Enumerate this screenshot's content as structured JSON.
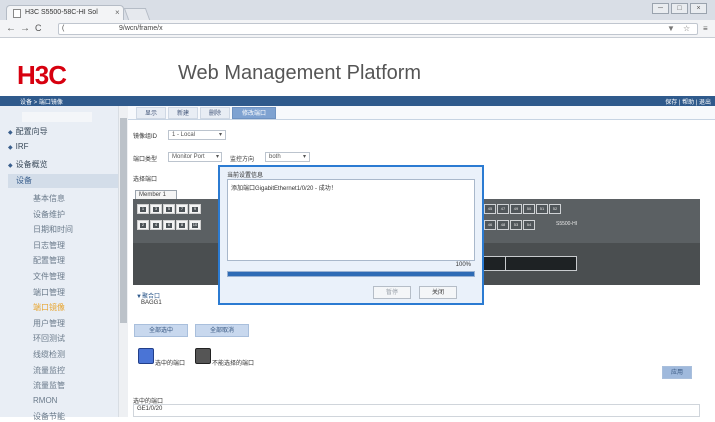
{
  "browser": {
    "tab_title": "H3C S5500-58C-HI Sol",
    "tab_close": "×",
    "nav_back": "←",
    "nav_forward": "→",
    "nav_reload": "C",
    "url_prefix": "(",
    "url_path": "9/wcn/frame/x",
    "win_min": "─",
    "win_max": "□",
    "win_close": "×",
    "bookmark_star": "☆",
    "menu_glyph": "≡"
  },
  "header": {
    "logo": "H3C",
    "title": "Web Management Platform",
    "breadcrumb": "设备 > 端口镜像",
    "top_links": "保存 | 帮助 | 退出"
  },
  "sidebar": {
    "top_items": [
      "配置向导",
      "IRF",
      "设备概览"
    ],
    "group": "设备",
    "sub_items": [
      "基本信息",
      "设备维护",
      "日期和时间",
      "日志管理",
      "配置管理",
      "文件管理",
      "端口管理",
      "端口镜像",
      "用户管理",
      "环回测试",
      "线缆检测",
      "流量监控",
      "流量监管",
      "RMON",
      "设备节能"
    ],
    "active_index": 7
  },
  "content": {
    "tabs": [
      "显示",
      "新建",
      "删除",
      "修改端口"
    ],
    "active_tab": 3,
    "group_id_label": "镜像组ID",
    "group_id_value": "1 - Local",
    "port_type_label": "端口类型",
    "port_type_value": "Monitor Port",
    "direction_label": "监控方向",
    "direction_value": "both",
    "select_port_label": "选择端口",
    "member_label": "Member 1",
    "ports_top_left": [
      "1",
      "3",
      "5",
      "7",
      "9"
    ],
    "ports_bottom_left": [
      "2",
      "4",
      "6",
      "8",
      "10"
    ],
    "ports_top_right": [
      "45",
      "47",
      "49",
      "50",
      "51",
      "52"
    ],
    "ports_bottom_right": [
      "46",
      "48",
      "53",
      "54"
    ],
    "model": "S5500-HI",
    "agg_label": "▼聚合口",
    "agg_value": "BAGG1",
    "select_all": "全部选中",
    "deselect_all": "全部取消",
    "legend_selected": "选中的端口",
    "legend_unselectable": "不能选择的端口",
    "apply": "应用",
    "selected_ports_label": "选中的端口",
    "selected_ports_value": "GE1/0/20"
  },
  "dialog": {
    "title": "当前设置信息",
    "message": "添加端口GigabitEthernet1/0/20 - 成功！",
    "progress_text": "100%",
    "progress": 1.0,
    "btn_pause": "暂停",
    "btn_close": "关闭"
  },
  "colors": {
    "brand_red": "#d7000f",
    "header_blue": "#2f5a8c",
    "dialog_border": "#2b7bd2",
    "legend_selected": "#4a74d6",
    "legend_unselectable": "#555555",
    "active_link": "#e8a530"
  }
}
